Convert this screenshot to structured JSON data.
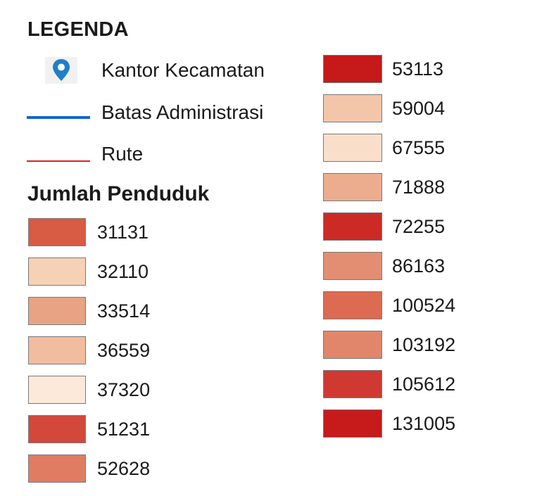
{
  "legend": {
    "title": "LEGENDA",
    "symbols": [
      {
        "label": "Kantor Kecamatan",
        "icon": "map-pin-icon",
        "color": "#1f7fc9"
      },
      {
        "label": "Batas Administrasi",
        "icon": "boundary-line",
        "color": "#1565d8"
      },
      {
        "label": "Rute",
        "icon": "route-line",
        "color": "#e02020"
      }
    ],
    "population_title": "Jumlah Penduduk",
    "classes": [
      {
        "value": "31131",
        "color": "#d85b44"
      },
      {
        "value": "32110",
        "color": "#f5d1b5"
      },
      {
        "value": "33514",
        "color": "#e8a385"
      },
      {
        "value": "36559",
        "color": "#f2bc9e"
      },
      {
        "value": "37320",
        "color": "#fde9da"
      },
      {
        "value": "51231",
        "color": "#d3483b"
      },
      {
        "value": "52628",
        "color": "#e07c62"
      },
      {
        "value": "53113",
        "color": "#c5191a"
      },
      {
        "value": "59004",
        "color": "#f3c6a9"
      },
      {
        "value": "67555",
        "color": "#f9dfca"
      },
      {
        "value": "71888",
        "color": "#ecad8f"
      },
      {
        "value": "72255",
        "color": "#cc2b25"
      },
      {
        "value": "86163",
        "color": "#e38e72"
      },
      {
        "value": "100524",
        "color": "#dc6b52"
      },
      {
        "value": "103192",
        "color": "#e2866b"
      },
      {
        "value": "105612",
        "color": "#cf3931"
      },
      {
        "value": "131005",
        "color": "#c61a1b"
      }
    ]
  }
}
